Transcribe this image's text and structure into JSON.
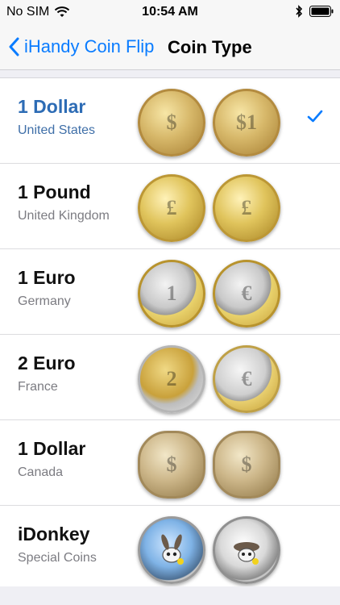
{
  "status_bar": {
    "carrier": "No SIM",
    "time": "10:54 AM"
  },
  "nav": {
    "back_label": "iHandy Coin Flip",
    "title": "Coin Type"
  },
  "coins": [
    {
      "name": "1 Dollar",
      "subtitle": "United States",
      "selected": true
    },
    {
      "name": "1 Pound",
      "subtitle": "United Kingdom",
      "selected": false
    },
    {
      "name": "1 Euro",
      "subtitle": "Germany",
      "selected": false
    },
    {
      "name": "2 Euro",
      "subtitle": "France",
      "selected": false
    },
    {
      "name": "1 Dollar",
      "subtitle": "Canada",
      "selected": false
    },
    {
      "name": "iDonkey",
      "subtitle": "Special Coins",
      "selected": false
    }
  ],
  "colors": {
    "accent": "#0a7cff",
    "selected_text": "#2d6cb5"
  },
  "icons": {
    "wifi": "wifi-icon",
    "bluetooth": "bluetooth-icon",
    "battery": "battery-icon",
    "back": "chevron-left-icon",
    "check": "checkmark-icon"
  }
}
